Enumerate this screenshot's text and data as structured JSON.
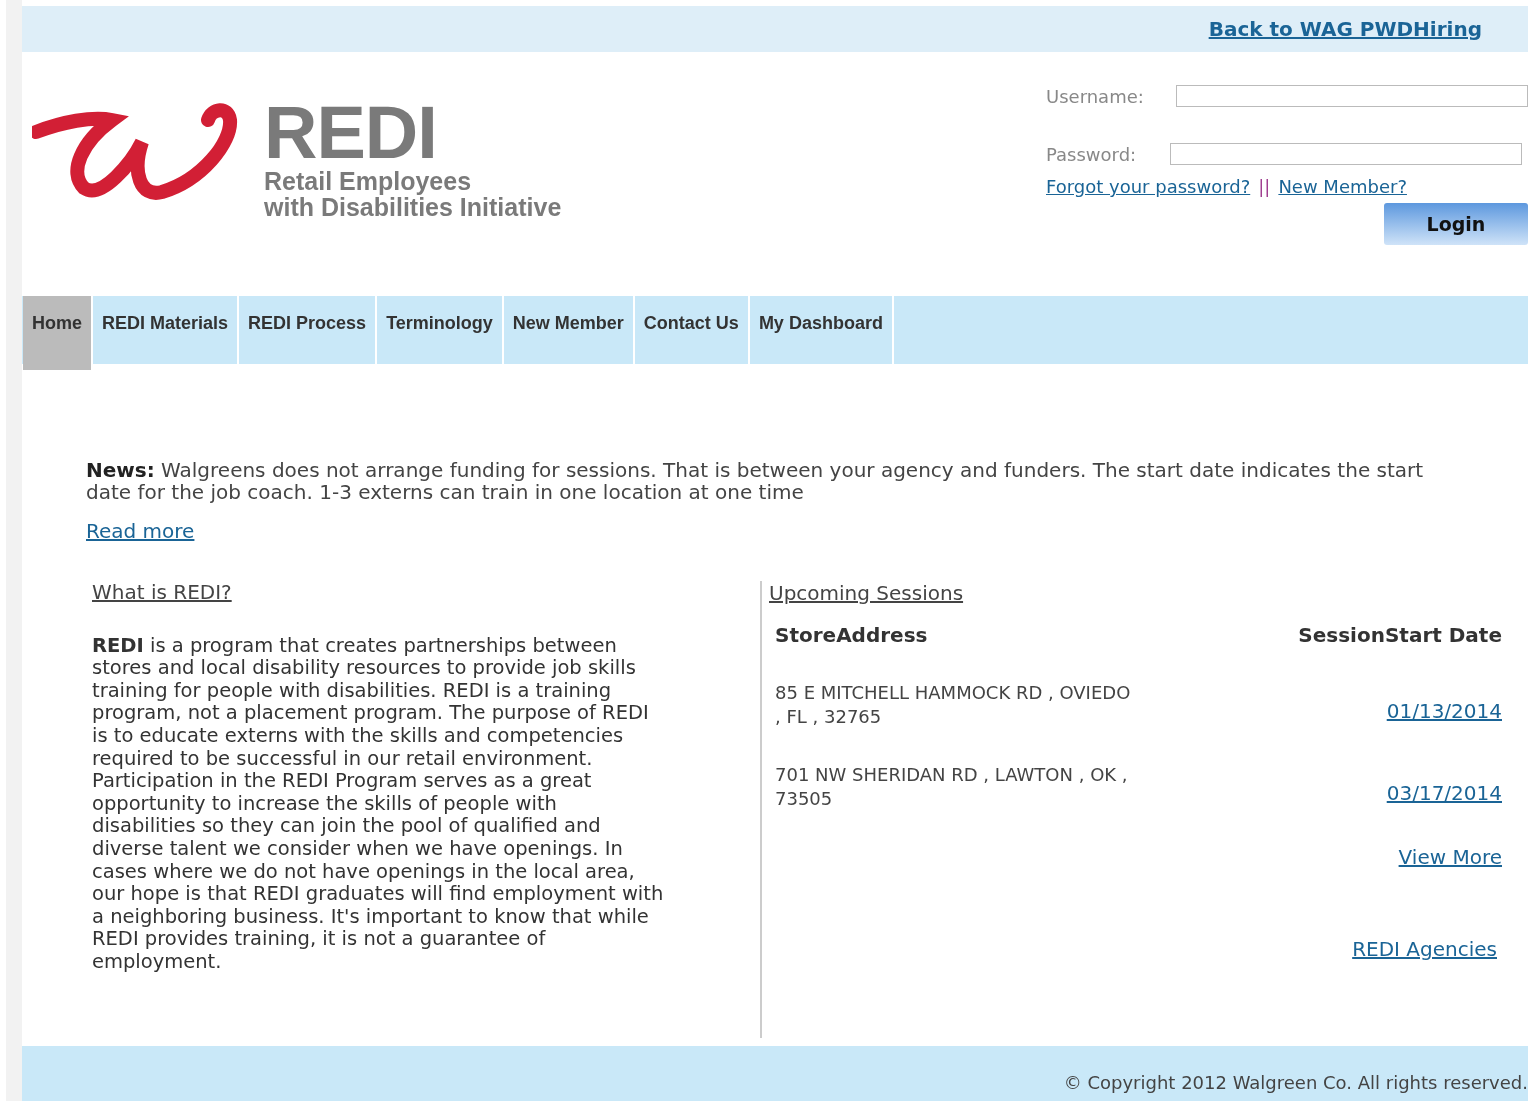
{
  "top_bar": {
    "link": "Back to WAG PWDHiring"
  },
  "logo": {
    "title": "REDI",
    "subtitle_1": "Retail Employees",
    "subtitle_2": "with Disabilities Initiative"
  },
  "login": {
    "username_label": "Username:",
    "password_label": "Password:",
    "forgot_link": "Forgot your password?",
    "separator": "||",
    "new_member_link": "New Member?",
    "button": "Login"
  },
  "nav": [
    {
      "label": "Home",
      "selected": true
    },
    {
      "label": "REDI Materials",
      "selected": false
    },
    {
      "label": "REDI Process",
      "selected": false
    },
    {
      "label": "Terminology",
      "selected": false
    },
    {
      "label": "New Member",
      "selected": false
    },
    {
      "label": "Contact Us",
      "selected": false
    },
    {
      "label": "My Dashboard",
      "selected": false
    }
  ],
  "news": {
    "text": "**News:** Walgreens does not arrange funding for sessions. That is between your agency and funders. The start date indicates the start date for the job coach. 1-3 externs can train in one location at one time",
    "read_more": "Read more"
  },
  "about": {
    "heading": "What is REDI?",
    "text": "**REDI** is a program that creates partnerships between stores and local disability resources to provide job skills training for people with disabilities. REDI is a training program, not a placement program. The purpose of REDI is to educate externs with the skills and competencies required to be successful in our retail environment. Participation in the REDI Program serves as a great opportunity to increase the skills of people with disabilities so they can join the pool of qualified and diverse talent we consider when we have openings. In cases where we do not have openings in the local area, our hope is that REDI graduates will find employment with a neighboring business. It's important to know that while REDI provides training, it is not a guarantee of employment."
  },
  "sessions": {
    "heading": "Upcoming Sessions",
    "columns": [
      "StoreAddress",
      "SessionStart Date"
    ],
    "rows": [
      {
        "address": "85 E MITCHELL HAMMOCK RD , OVIEDO , FL , 32765",
        "date": "01/13/2014"
      },
      {
        "address": "701 NW SHERIDAN RD , LAWTON , OK , 73505",
        "date": "03/17/2014"
      }
    ],
    "view_more": "View More",
    "agencies": "REDI Agencies"
  },
  "footer": {
    "copyright": "© Copyright 2012 Walgreen Co. All rights reserved."
  }
}
